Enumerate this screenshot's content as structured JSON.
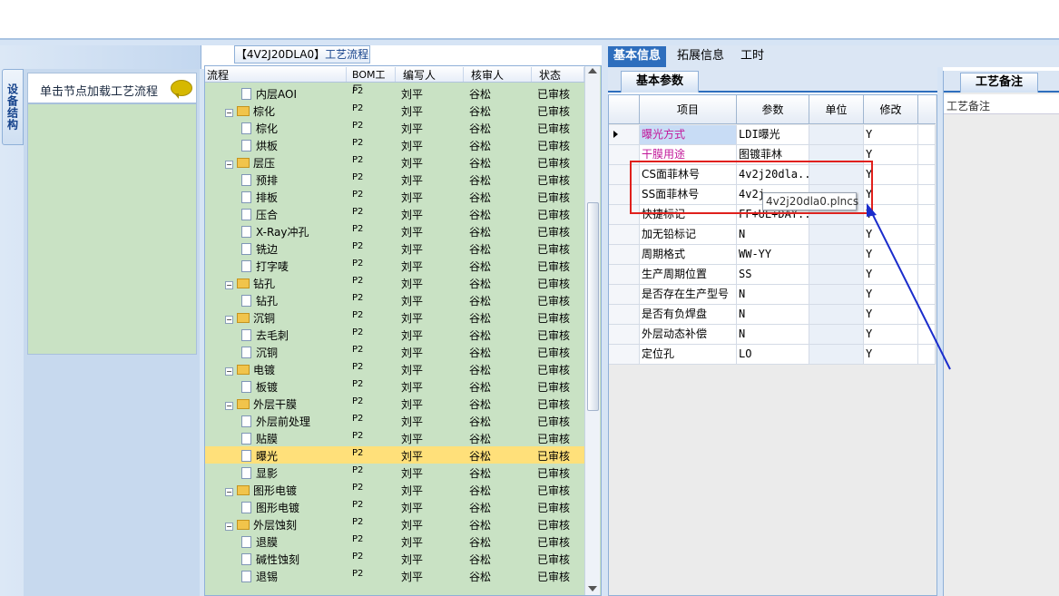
{
  "left_panel": {
    "side_tab": "设备结构",
    "click_hint": "单击节点加载工艺流程"
  },
  "tree": {
    "title_bracket": "【4V2J20DLA0】",
    "title_text": "工艺流程",
    "columns": [
      "流程",
      "BOM工厂",
      "编写人",
      "核审人",
      "状态"
    ],
    "rows": [
      {
        "name": "内层AOI",
        "type": "doc",
        "level": 1,
        "bom": "P2",
        "writer": "刘平",
        "reviewer": "谷松",
        "status": "已审核"
      },
      {
        "name": "棕化",
        "type": "folder",
        "level": 0,
        "bom": "P2",
        "writer": "刘平",
        "reviewer": "谷松",
        "status": "已审核"
      },
      {
        "name": "棕化",
        "type": "doc",
        "level": 1,
        "bom": "P2",
        "writer": "刘平",
        "reviewer": "谷松",
        "status": "已审核"
      },
      {
        "name": "烘板",
        "type": "doc",
        "level": 1,
        "bom": "P2",
        "writer": "刘平",
        "reviewer": "谷松",
        "status": "已审核"
      },
      {
        "name": "层压",
        "type": "folder",
        "level": 0,
        "bom": "P2",
        "writer": "刘平",
        "reviewer": "谷松",
        "status": "已审核"
      },
      {
        "name": "预排",
        "type": "doc",
        "level": 1,
        "bom": "P2",
        "writer": "刘平",
        "reviewer": "谷松",
        "status": "已审核"
      },
      {
        "name": "排板",
        "type": "doc",
        "level": 1,
        "bom": "P2",
        "writer": "刘平",
        "reviewer": "谷松",
        "status": "已审核"
      },
      {
        "name": "压合",
        "type": "doc",
        "level": 1,
        "bom": "P2",
        "writer": "刘平",
        "reviewer": "谷松",
        "status": "已审核"
      },
      {
        "name": "X-Ray冲孔",
        "type": "doc",
        "level": 1,
        "bom": "P2",
        "writer": "刘平",
        "reviewer": "谷松",
        "status": "已审核"
      },
      {
        "name": "铣边",
        "type": "doc",
        "level": 1,
        "bom": "P2",
        "writer": "刘平",
        "reviewer": "谷松",
        "status": "已审核"
      },
      {
        "name": "打字唛",
        "type": "doc",
        "level": 1,
        "bom": "P2",
        "writer": "刘平",
        "reviewer": "谷松",
        "status": "已审核"
      },
      {
        "name": "钻孔",
        "type": "folder",
        "level": 0,
        "bom": "P2",
        "writer": "刘平",
        "reviewer": "谷松",
        "status": "已审核"
      },
      {
        "name": "钻孔",
        "type": "doc",
        "level": 1,
        "bom": "P2",
        "writer": "刘平",
        "reviewer": "谷松",
        "status": "已审核"
      },
      {
        "name": "沉铜",
        "type": "folder",
        "level": 0,
        "bom": "P2",
        "writer": "刘平",
        "reviewer": "谷松",
        "status": "已审核"
      },
      {
        "name": "去毛刺",
        "type": "doc",
        "level": 1,
        "bom": "P2",
        "writer": "刘平",
        "reviewer": "谷松",
        "status": "已审核"
      },
      {
        "name": "沉铜",
        "type": "doc",
        "level": 1,
        "bom": "P2",
        "writer": "刘平",
        "reviewer": "谷松",
        "status": "已审核"
      },
      {
        "name": "电镀",
        "type": "folder",
        "level": 0,
        "bom": "P2",
        "writer": "刘平",
        "reviewer": "谷松",
        "status": "已审核"
      },
      {
        "name": "板镀",
        "type": "doc",
        "level": 1,
        "bom": "P2",
        "writer": "刘平",
        "reviewer": "谷松",
        "status": "已审核"
      },
      {
        "name": "外层干膜",
        "type": "folder",
        "level": 0,
        "bom": "P2",
        "writer": "刘平",
        "reviewer": "谷松",
        "status": "已审核"
      },
      {
        "name": "外层前处理",
        "type": "doc",
        "level": 1,
        "bom": "P2",
        "writer": "刘平",
        "reviewer": "谷松",
        "status": "已审核"
      },
      {
        "name": "贴膜",
        "type": "doc",
        "level": 1,
        "bom": "P2",
        "writer": "刘平",
        "reviewer": "谷松",
        "status": "已审核"
      },
      {
        "name": "曝光",
        "type": "doc",
        "level": 1,
        "bom": "P2",
        "writer": "刘平",
        "reviewer": "谷松",
        "status": "已审核",
        "selected": true
      },
      {
        "name": "显影",
        "type": "doc",
        "level": 1,
        "bom": "P2",
        "writer": "刘平",
        "reviewer": "谷松",
        "status": "已审核"
      },
      {
        "name": "图形电镀",
        "type": "folder",
        "level": 0,
        "bom": "P2",
        "writer": "刘平",
        "reviewer": "谷松",
        "status": "已审核"
      },
      {
        "name": "图形电镀",
        "type": "doc",
        "level": 1,
        "bom": "P2",
        "writer": "刘平",
        "reviewer": "谷松",
        "status": "已审核"
      },
      {
        "name": "外层蚀刻",
        "type": "folder",
        "level": 0,
        "bom": "P2",
        "writer": "刘平",
        "reviewer": "谷松",
        "status": "已审核"
      },
      {
        "name": "退膜",
        "type": "doc",
        "level": 1,
        "bom": "P2",
        "writer": "刘平",
        "reviewer": "谷松",
        "status": "已审核"
      },
      {
        "name": "碱性蚀刻",
        "type": "doc",
        "level": 1,
        "bom": "P2",
        "writer": "刘平",
        "reviewer": "谷松",
        "status": "已审核"
      },
      {
        "name": "退锡",
        "type": "doc",
        "level": 1,
        "bom": "P2",
        "writer": "刘平",
        "reviewer": "谷松",
        "status": "已审核"
      }
    ]
  },
  "right": {
    "tabs": [
      "基本信息",
      "拓展信息",
      "工时"
    ],
    "active_tab": 0,
    "sub_tab": "基本参数",
    "grid_headers": [
      "项目",
      "参数",
      "单位",
      "修改"
    ],
    "grid_rows": [
      {
        "item": "曝光方式",
        "value": "LDI曝光",
        "unit": "",
        "mod": "Y",
        "highlight": "pink",
        "current": true
      },
      {
        "item": "干膜用途",
        "value": "图镀菲林",
        "unit": "",
        "mod": "Y",
        "highlight": "pink"
      },
      {
        "item": "CS面菲林号",
        "value": "4v2j20dla...",
        "unit": "",
        "mod": "Y"
      },
      {
        "item": "SS面菲林号",
        "value": "4v2j",
        "unit": "",
        "mod": "Y"
      },
      {
        "item": "快捷标记",
        "value": "FF+UL+DAY...",
        "unit": "",
        "mod": "Y"
      },
      {
        "item": "加无铅标记",
        "value": "N",
        "unit": "",
        "mod": "Y"
      },
      {
        "item": "周期格式",
        "value": "WW-YY",
        "unit": "",
        "mod": "Y"
      },
      {
        "item": "生产周期位置",
        "value": "SS",
        "unit": "",
        "mod": "Y"
      },
      {
        "item": "是否存在生产型号",
        "value": "N",
        "unit": "",
        "mod": "Y"
      },
      {
        "item": "是否有负焊盘",
        "value": "N",
        "unit": "",
        "mod": "Y"
      },
      {
        "item": "外层动态补偿",
        "value": "N",
        "unit": "",
        "mod": "Y"
      },
      {
        "item": "定位孔",
        "value": "LO",
        "unit": "",
        "mod": "Y"
      }
    ],
    "tooltip": "4v2j20dla0.plncs"
  },
  "notes": {
    "tab": "工艺备注",
    "label": "工艺备注"
  },
  "colors": {
    "accent": "#2e6ebd",
    "tree_bg": "#c9e2c4",
    "selected_row": "#ffe07a",
    "annotation_red": "#e0201c",
    "arrow_blue": "#1a2ccc"
  }
}
